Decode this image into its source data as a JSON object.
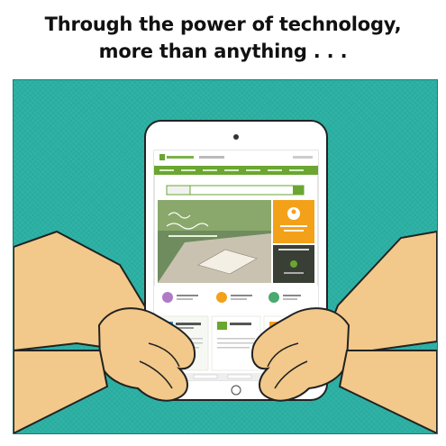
{
  "caption": {
    "line1": "Through the power of technology,",
    "line2": "more than anything . . ."
  },
  "colors": {
    "background": "#2bb0a3",
    "skin": "#f2c98a",
    "tablet_frame": "#ffffff",
    "site_green": "#6aa631",
    "site_orange": "#f4a11a"
  },
  "icons": [
    "camera-icon",
    "home-button-icon"
  ]
}
